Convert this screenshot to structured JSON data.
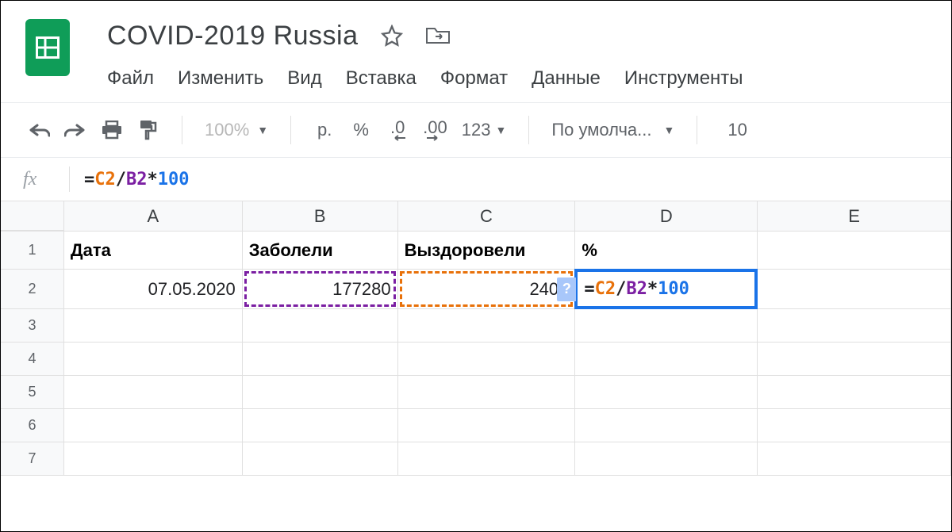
{
  "doc": {
    "title": "COVID-2019 Russia"
  },
  "menu": {
    "file": "Файл",
    "edit": "Изменить",
    "view": "Вид",
    "insert": "Вставка",
    "format": "Формат",
    "data": "Данные",
    "tools": "Инструменты"
  },
  "toolbar": {
    "zoom": "100%",
    "currency": "р.",
    "percent": "%",
    "dec_less": ".0",
    "dec_more": ".00",
    "more_formats": "123",
    "font": "По умолча...",
    "font_size": "10"
  },
  "formula_bar": {
    "eq": "=",
    "ref1": "C2",
    "op1": "/",
    "ref2": "B2",
    "op2": "*",
    "num": "100"
  },
  "columns": {
    "a": "A",
    "b": "B",
    "c": "C",
    "d": "D",
    "e": "E"
  },
  "row_headers": [
    "1",
    "2",
    "3",
    "4",
    "5",
    "6",
    "7"
  ],
  "cells": {
    "a1": "Дата",
    "b1": "Заболели",
    "c1": "Выздоровели",
    "d1": "%",
    "a2": "07.05.2020",
    "b2": "177280",
    "c2": "2402"
  },
  "editing": {
    "help": "?"
  }
}
